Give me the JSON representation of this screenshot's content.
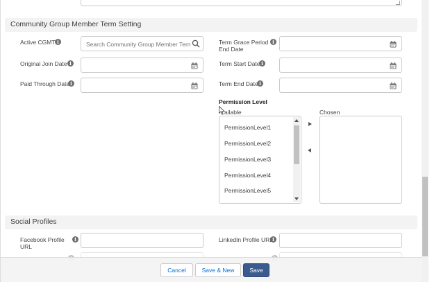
{
  "sections": {
    "cgmt": {
      "title": "Community Group Member Term Setting"
    },
    "social": {
      "title": "Social Profiles"
    }
  },
  "fields": {
    "active_cgmt": {
      "label": "Active CGMT",
      "placeholder": "Search Community Group Member Term"
    },
    "original_join_date": {
      "label": "Original Join Date",
      "value": ""
    },
    "paid_through_date": {
      "label": "Paid Through Date",
      "value": ""
    },
    "term_grace_period_end_date": {
      "label_line1": "Term Grace Period",
      "label_line2": "End Date",
      "value": ""
    },
    "term_start_date": {
      "label": "Term Start Date",
      "value": ""
    },
    "term_end_date": {
      "label": "Term End Date",
      "value": ""
    },
    "facebook_profile_url": {
      "label_line1": "Facebook Profile",
      "label_line2": "URL",
      "value": ""
    },
    "linkedin_profile_url": {
      "label": "LinkedIn Profile URL",
      "value": ""
    }
  },
  "permission_level": {
    "heading": "Permission Level",
    "available_label": "ailable",
    "chosen_label": "Chosen",
    "available_items": [
      "PermissionLevel1",
      "PermissionLevel2",
      "PermissionLevel3",
      "PermissionLevel4",
      "PermissionLevel5"
    ]
  },
  "footer": {
    "cancel_label": "Cancel",
    "save_new_label": "Save & New",
    "save_label": "Save"
  },
  "icons": {
    "info": "info-icon",
    "search": "search-icon",
    "calendar": "calendar-icon"
  },
  "colors": {
    "primary_button": "#3b5b8e",
    "link_text": "#0070d2",
    "section_bg": "#f3f3f3"
  }
}
